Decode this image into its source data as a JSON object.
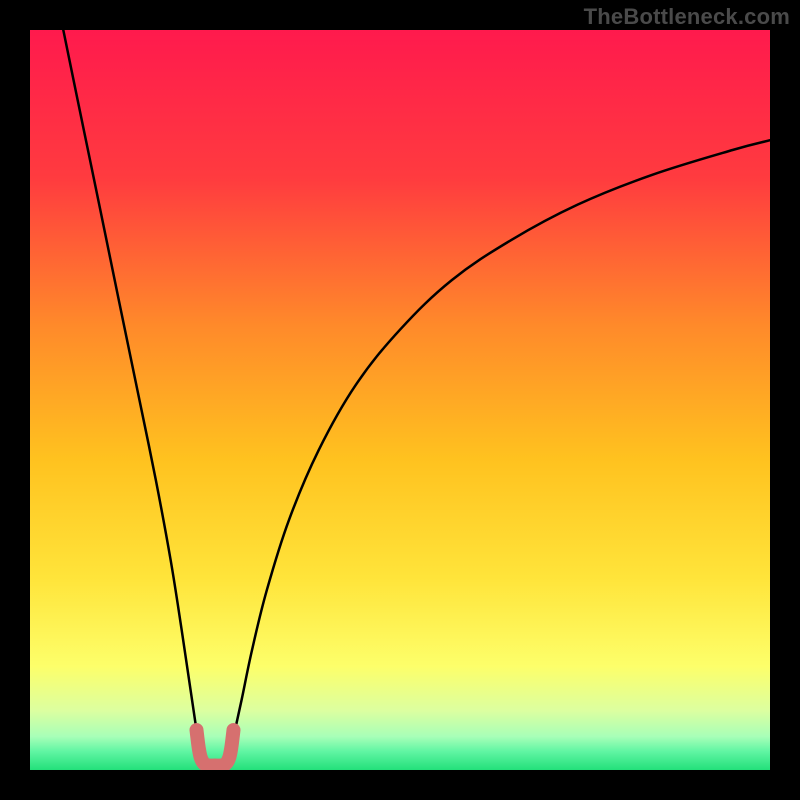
{
  "watermark": "TheBottleneck.com",
  "chart_data": {
    "type": "line",
    "title": "",
    "xlabel": "",
    "ylabel": "",
    "xlim": [
      0,
      100
    ],
    "ylim": [
      0,
      100
    ],
    "grid": false,
    "annotations": [],
    "background_gradient": {
      "stops": [
        {
          "pos": 0.0,
          "color": "#ff1a4d"
        },
        {
          "pos": 0.2,
          "color": "#ff3b3f"
        },
        {
          "pos": 0.4,
          "color": "#ff8a2a"
        },
        {
          "pos": 0.58,
          "color": "#ffc21f"
        },
        {
          "pos": 0.74,
          "color": "#ffe43a"
        },
        {
          "pos": 0.86,
          "color": "#fdff6a"
        },
        {
          "pos": 0.92,
          "color": "#dcffa0"
        },
        {
          "pos": 0.955,
          "color": "#a7ffb8"
        },
        {
          "pos": 0.975,
          "color": "#60f5a3"
        },
        {
          "pos": 1.0,
          "color": "#23e07a"
        }
      ]
    },
    "series": [
      {
        "name": "bottleneck-curve-left",
        "color": "#000000",
        "x": [
          4.5,
          7,
          9.5,
          12,
          14.5,
          17,
          19,
          20.5,
          21.7,
          22.5,
          23.0
        ],
        "y": [
          100,
          87.8,
          75.7,
          63.5,
          51.4,
          39.2,
          28.4,
          18.9,
          10.8,
          5.4,
          2.3
        ]
      },
      {
        "name": "bottleneck-curve-right",
        "color": "#000000",
        "x": [
          27.0,
          27.7,
          28.6,
          30,
          32,
          35,
          39,
          44,
          50,
          57,
          65,
          74,
          84,
          95,
          100
        ],
        "y": [
          2.3,
          5.4,
          9.5,
          16.2,
          24.3,
          33.8,
          43.2,
          52.0,
          59.5,
          66.2,
          71.6,
          76.4,
          80.4,
          83.8,
          85.1
        ]
      },
      {
        "name": "optimal-zone-marker",
        "color": "#d6706f",
        "x": [
          22.5,
          22.8,
          23.1,
          23.6,
          24.3,
          25.0,
          25.7,
          26.4,
          26.9,
          27.2,
          27.5
        ],
        "y": [
          5.4,
          3.0,
          1.6,
          0.8,
          0.6,
          0.6,
          0.6,
          0.8,
          1.6,
          3.0,
          5.4
        ]
      }
    ]
  }
}
